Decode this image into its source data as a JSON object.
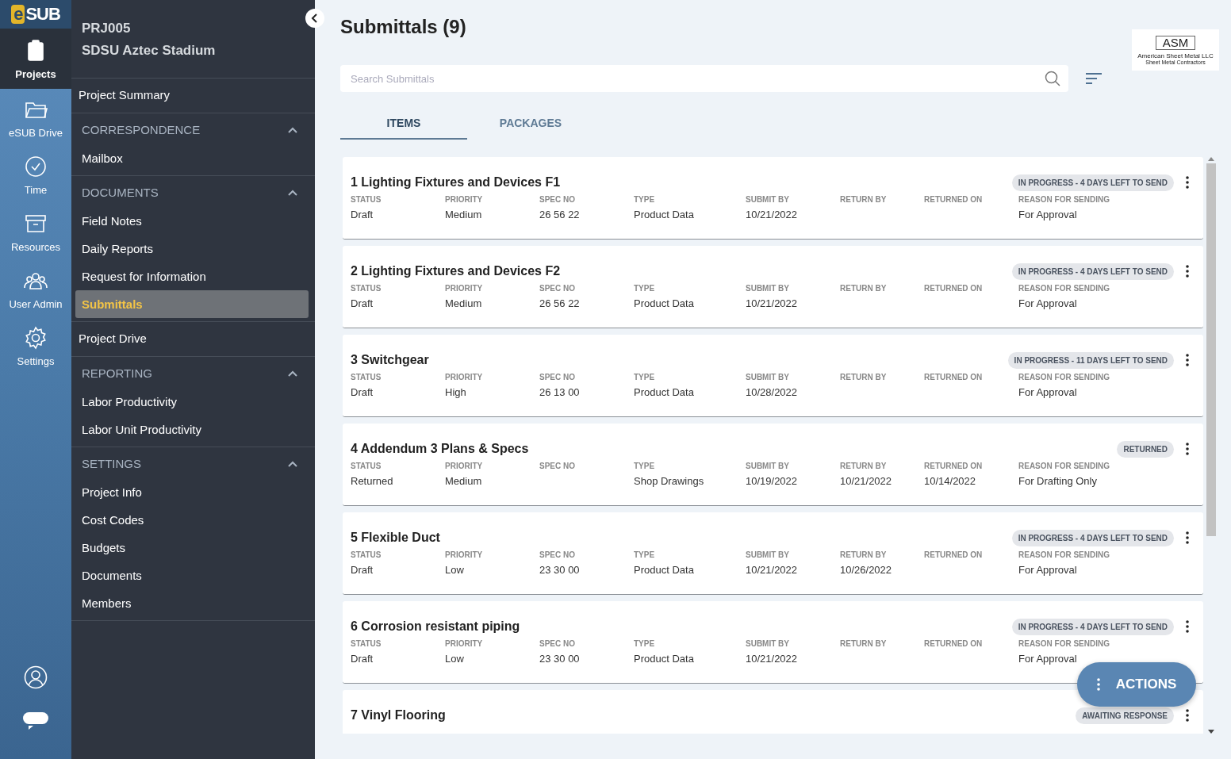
{
  "rail": {
    "logo": {
      "mark": "e",
      "text": "SUB"
    },
    "items": [
      {
        "label": "Projects",
        "selected": true
      },
      {
        "label": "eSUB Drive",
        "selected": false
      },
      {
        "label": "Time",
        "selected": false
      },
      {
        "label": "Resources",
        "selected": false
      },
      {
        "label": "User Admin",
        "selected": false
      },
      {
        "label": "Settings",
        "selected": false
      }
    ]
  },
  "project": {
    "code": "PRJ005",
    "name": "SDSU Aztec Stadium"
  },
  "nav": [
    {
      "kind": "link",
      "label": "Project Summary",
      "selected": false
    },
    {
      "kind": "section",
      "label": "CORRESPONDENCE",
      "expanded": true,
      "items": [
        {
          "label": "Mailbox",
          "selected": false
        }
      ]
    },
    {
      "kind": "section",
      "label": "DOCUMENTS",
      "expanded": true,
      "items": [
        {
          "label": "Field Notes",
          "selected": false
        },
        {
          "label": "Daily Reports",
          "selected": false
        },
        {
          "label": "Request for Information",
          "selected": false
        },
        {
          "label": "Submittals",
          "selected": true
        }
      ]
    },
    {
      "kind": "link",
      "label": "Project Drive",
      "selected": false
    },
    {
      "kind": "section",
      "label": "REPORTING",
      "expanded": true,
      "items": [
        {
          "label": "Labor Productivity",
          "selected": false
        },
        {
          "label": "Labor Unit Productivity",
          "selected": false
        }
      ]
    },
    {
      "kind": "section",
      "label": "SETTINGS",
      "expanded": true,
      "items": [
        {
          "label": "Project Info",
          "selected": false
        },
        {
          "label": "Cost Codes",
          "selected": false
        },
        {
          "label": "Budgets",
          "selected": false
        },
        {
          "label": "Documents",
          "selected": false
        },
        {
          "label": "Members",
          "selected": false
        }
      ]
    }
  ],
  "title": "Submittals (9)",
  "company_logo": {
    "mark": "ASM",
    "name": "American Sheet Metal LLC",
    "tagline": "Sheet Metal Contractors"
  },
  "search": {
    "placeholder": "Search Submittals"
  },
  "tabs": [
    {
      "label": "ITEMS",
      "selected": true
    },
    {
      "label": "PACKAGES",
      "selected": false
    }
  ],
  "submittals": [
    {
      "title": "1 Lighting Fixtures and Devices F1",
      "badge": "IN PROGRESS - 4 DAYS LEFT TO SEND",
      "fields": [
        {
          "label": "STATUS",
          "value": "Draft"
        },
        {
          "label": "PRIORITY",
          "value": "Medium"
        },
        {
          "label": "SPEC NO",
          "value": "26 56 22"
        },
        {
          "label": "TYPE",
          "value": "Product Data"
        },
        {
          "label": "SUBMIT BY",
          "value": "10/21/2022"
        },
        {
          "label": "RETURN BY"
        },
        {
          "label": "RETURNED ON"
        },
        {
          "label": "REASON FOR SENDING",
          "value": "For Approval"
        }
      ]
    },
    {
      "title": "2 Lighting Fixtures and Devices F2",
      "badge": "IN PROGRESS - 4 DAYS LEFT TO SEND",
      "fields": [
        {
          "label": "STATUS",
          "value": "Draft"
        },
        {
          "label": "PRIORITY",
          "value": "Medium"
        },
        {
          "label": "SPEC NO",
          "value": "26 56 22"
        },
        {
          "label": "TYPE",
          "value": "Product Data"
        },
        {
          "label": "SUBMIT BY",
          "value": "10/21/2022"
        },
        {
          "label": "RETURN BY"
        },
        {
          "label": "RETURNED ON"
        },
        {
          "label": "REASON FOR SENDING",
          "value": "For Approval"
        }
      ]
    },
    {
      "title": "3 Switchgear",
      "badge": "IN PROGRESS - 11 DAYS LEFT TO SEND",
      "fields": [
        {
          "label": "STATUS",
          "value": "Draft"
        },
        {
          "label": "PRIORITY",
          "value": "High"
        },
        {
          "label": "SPEC NO",
          "value": "26 13 00"
        },
        {
          "label": "TYPE",
          "value": "Product Data"
        },
        {
          "label": "SUBMIT BY",
          "value": "10/28/2022"
        },
        {
          "label": "RETURN BY"
        },
        {
          "label": "RETURNED ON"
        },
        {
          "label": "REASON FOR SENDING",
          "value": "For Approval"
        }
      ]
    },
    {
      "title": "4 Addendum 3 Plans & Specs",
      "badge": "RETURNED",
      "fields": [
        {
          "label": "STATUS",
          "value": "Returned"
        },
        {
          "label": "PRIORITY",
          "value": "Medium"
        },
        {
          "label": "SPEC NO"
        },
        {
          "label": "TYPE",
          "value": "Shop Drawings"
        },
        {
          "label": "SUBMIT BY",
          "value": "10/19/2022"
        },
        {
          "label": "RETURN BY",
          "value": "10/21/2022"
        },
        {
          "label": "RETURNED ON",
          "value": "10/14/2022"
        },
        {
          "label": "REASON FOR SENDING",
          "value": "For Drafting Only"
        }
      ]
    },
    {
      "title": "5 Flexible Duct",
      "badge": "IN PROGRESS - 4 DAYS LEFT TO SEND",
      "fields": [
        {
          "label": "STATUS",
          "value": "Draft"
        },
        {
          "label": "PRIORITY",
          "value": "Low"
        },
        {
          "label": "SPEC NO",
          "value": "23 30 00"
        },
        {
          "label": "TYPE",
          "value": "Product Data"
        },
        {
          "label": "SUBMIT BY",
          "value": "10/21/2022"
        },
        {
          "label": "RETURN BY",
          "value": "10/26/2022"
        },
        {
          "label": "RETURNED ON"
        },
        {
          "label": "REASON FOR SENDING",
          "value": "For Approval"
        }
      ]
    },
    {
      "title": "6 Corrosion resistant piping",
      "badge": "IN PROGRESS - 4 DAYS LEFT TO SEND",
      "fields": [
        {
          "label": "STATUS",
          "value": "Draft"
        },
        {
          "label": "PRIORITY",
          "value": "Low"
        },
        {
          "label": "SPEC NO",
          "value": "23 30 00"
        },
        {
          "label": "TYPE",
          "value": "Product Data"
        },
        {
          "label": "SUBMIT BY",
          "value": "10/21/2022"
        },
        {
          "label": "RETURN BY"
        },
        {
          "label": "RETURNED ON"
        },
        {
          "label": "REASON FOR SENDING",
          "value": "For Approval"
        }
      ]
    },
    {
      "title": "7 Vinyl Flooring",
      "badge": "AWAITING RESPONSE"
    }
  ],
  "actions_button": {
    "label": "ACTIONS"
  }
}
